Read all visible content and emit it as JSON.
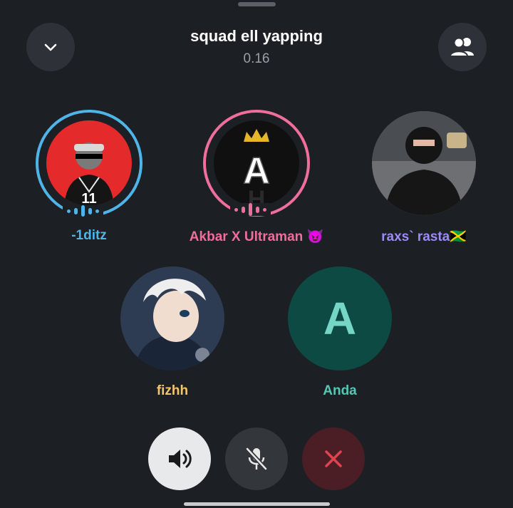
{
  "header": {
    "title": "squad ell yapping",
    "duration": "0.16"
  },
  "participants": [
    {
      "name": "-1ditz",
      "color": "#4fb4e8",
      "speaking": true,
      "avatar": "red-circle-portrait"
    },
    {
      "name": "Akbar X Ultraman 😈",
      "color": "#f06e9a",
      "speaking": true,
      "avatar": "crown-letter-a"
    },
    {
      "name": "raxs` rasta🇯🇲",
      "color": "#9a8cf4",
      "speaking": false,
      "avatar": "masked-person-photo"
    },
    {
      "name": "fizhh",
      "color": "#f3c66b",
      "speaking": false,
      "avatar": "anime-character"
    },
    {
      "name": "Anda",
      "color": "#57c7b4",
      "speaking": false,
      "avatar": "initial",
      "initial": "A",
      "avatar_bg": "#0d4a44"
    }
  ],
  "controls": {
    "speaker": "speaker-icon",
    "mic": "mic-off-icon",
    "end": "close-icon"
  },
  "colors": {
    "background": "#1c1f24",
    "end_call": "#e0434f"
  }
}
